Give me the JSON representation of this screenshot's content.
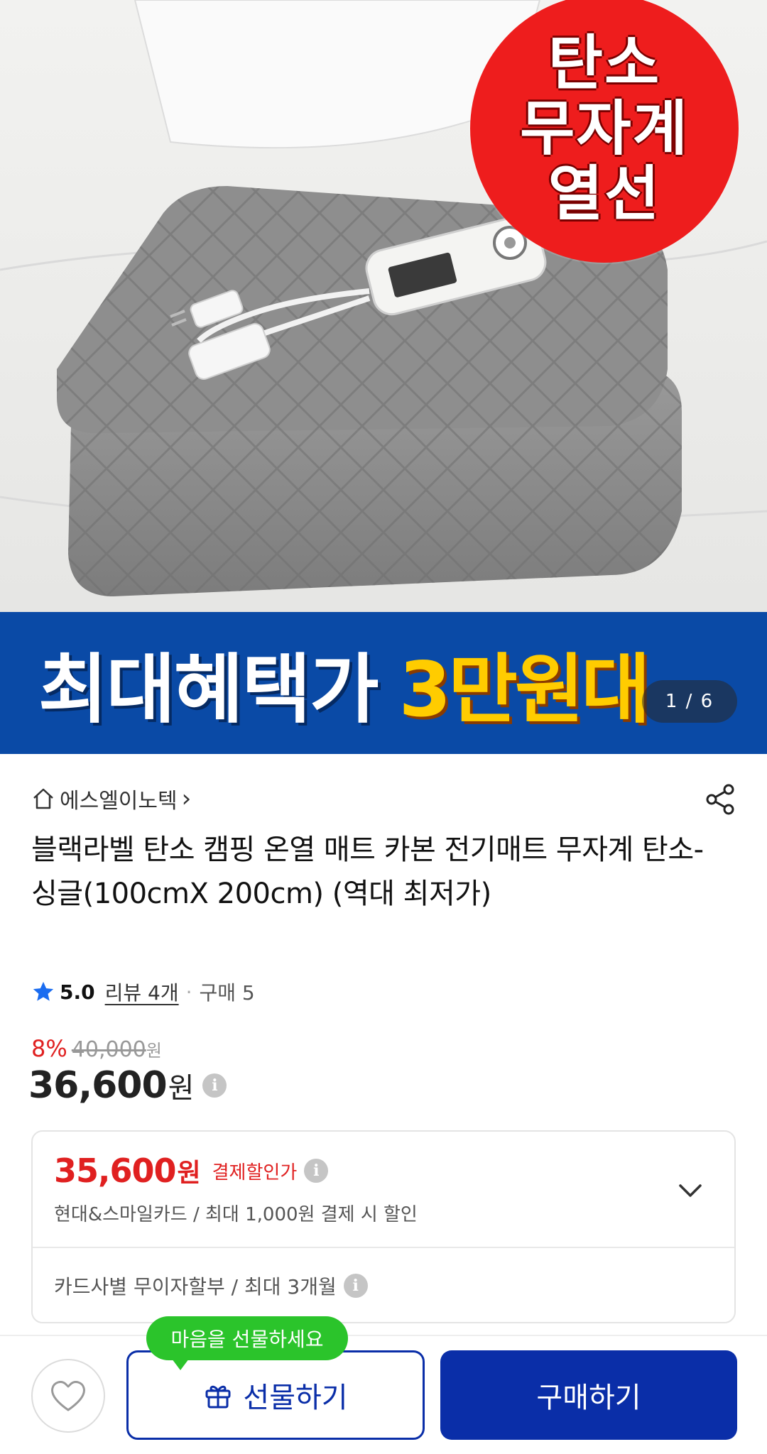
{
  "hero": {
    "badge_lines": [
      "탄소",
      "무자계",
      "열선"
    ],
    "banner_white": "최대혜택가",
    "banner_gold": "3만원대",
    "page_indicator": "1 / 6"
  },
  "seller": {
    "icon": "home-icon",
    "name": "에스엘이노텍",
    "chevron": "›",
    "share_icon": "share-icon"
  },
  "product": {
    "title": "블랙라벨 탄소 캠핑 온열 매트 카본 전기매트 무자계 탄소-싱글(100cmX 200cm) (역대 최저가)"
  },
  "rating": {
    "star_icon": "star-icon",
    "score": "5.0",
    "review_label": "리뷰 4개",
    "separator": "·",
    "purchase_label": "구매 5"
  },
  "price": {
    "discount": "8%",
    "original": "40,000",
    "original_unit": "원",
    "current": "36,600",
    "current_unit": "원",
    "info": "i"
  },
  "benefit": {
    "price": "35,600",
    "unit": "원",
    "label": "결제할인가",
    "info": "i",
    "card_desc": "현대&스마일카드 / 최대 1,000원 결제 시 할인",
    "installment": "카드사별 무이자할부 / 최대 3개월",
    "chevron_icon": "chevron-down-icon"
  },
  "actions": {
    "wish_icon": "heart-icon",
    "gift_tooltip": "마음을 선물하세요",
    "gift_label": "선물하기",
    "gift_icon": "gift-icon",
    "buy_label": "구매하기"
  },
  "colors": {
    "brand_blue": "#0a2ea8",
    "sale_red": "#e02020",
    "tooltip_green": "#2bc42b",
    "badge_red": "#ee1d1d",
    "banner_blue": "#0a4aa6",
    "banner_gold": "#ffcc00"
  }
}
